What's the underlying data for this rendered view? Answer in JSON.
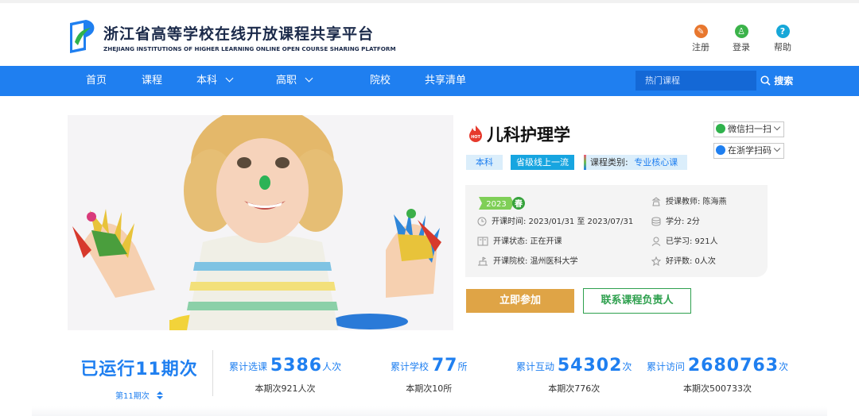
{
  "header": {
    "brand_cn": "浙江省高等学校在线开放课程共享平台",
    "brand_en": "ZHEJIANG INSTITUTIONS OF HIGHER LEARNING ONLINE OPEN COURSE SHARING PLATFORM",
    "links": [
      {
        "label": "注册",
        "icon": "register-icon",
        "color": "#e8772e"
      },
      {
        "label": "登录",
        "icon": "user-icon",
        "color": "#3bb34a"
      },
      {
        "label": "帮助",
        "icon": "help-icon",
        "color": "#16a7d8"
      }
    ]
  },
  "nav": {
    "items": [
      "首页",
      "课程",
      "本科",
      "高职",
      "院校",
      "共享清单"
    ],
    "search_placeholder": "热门课程",
    "search_button": "搜索"
  },
  "course": {
    "title": "儿科护理学",
    "tags": [
      "本科",
      "省级线上一流"
    ],
    "category_label": "课程类别:",
    "category_value": "专业核心课",
    "share_wechat": "微信扫一扫",
    "share_app": "在浙学扫码",
    "year": "2023",
    "season": "春",
    "info": {
      "period": "开课时间:  2023/01/31 至 2023/07/31",
      "status": "开课状态:  正在开课",
      "school": "开课院校:  温州医科大学",
      "teacher": "授课教师:  陈海燕",
      "credit": "学分:  2分",
      "learned": "已学习:  921人",
      "rating": "好评数:  0人次"
    },
    "join_button": "立即参加",
    "contact_button": "联系课程负责人"
  },
  "stats": {
    "run_title": "已运行11期次",
    "current_period": "第11期次",
    "items": [
      {
        "label": "累计选课",
        "value": "5386",
        "unit": "人次",
        "sub": "本期次921人次"
      },
      {
        "label": "累计学校",
        "value": "77",
        "unit": "所",
        "sub": "本期次10所"
      },
      {
        "label": "累计互动",
        "value": "54302",
        "unit": "次",
        "sub": "本期次776次"
      },
      {
        "label": "累计访问",
        "value": "2680763",
        "unit": "次",
        "sub": "本期次500733次"
      }
    ]
  },
  "colors": {
    "primary": "#1f7ff0",
    "join": "#dfa446",
    "contact": "#2ea04e"
  }
}
